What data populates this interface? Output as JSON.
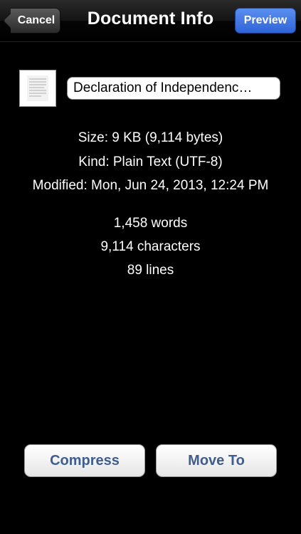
{
  "navbar": {
    "title": "Document Info",
    "cancel_label": "Cancel",
    "preview_label": "Preview"
  },
  "document": {
    "icon": "text-document-icon",
    "name": "Declaration of Independenc…"
  },
  "info": {
    "size": "Size: 9 KB (9,114 bytes)",
    "kind": "Kind: Plain Text (UTF-8)",
    "modified": "Modified: Mon, Jun 24, 2013, 12:24 PM"
  },
  "stats": {
    "words": "1,458 words",
    "characters": "9,114 characters",
    "lines": "89 lines"
  },
  "actions": {
    "compress_label": "Compress",
    "move_label": "Move To"
  },
  "colors": {
    "background": "#000000",
    "preview_button": "#3a72e0",
    "action_text": "#3f5d8f"
  }
}
